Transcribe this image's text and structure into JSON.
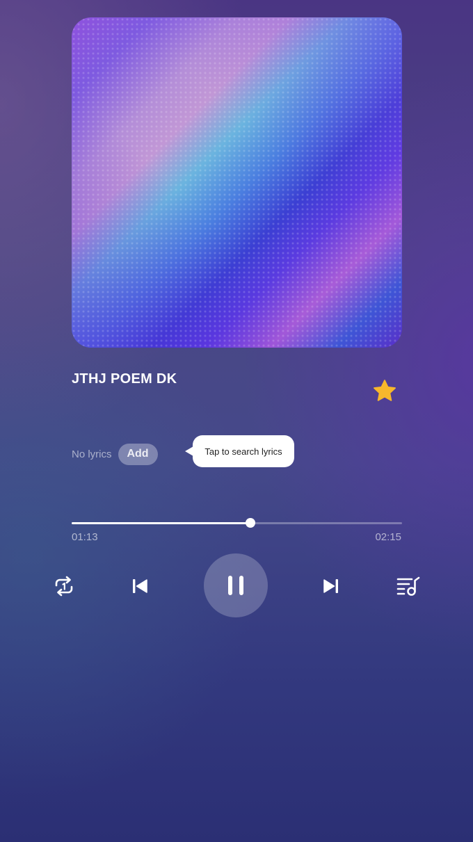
{
  "now_playing": {
    "title": "JTHJ POEM DK",
    "is_favorite": true,
    "favorite_icon": "star-icon",
    "favorite_color": "#f7b72c"
  },
  "lyrics": {
    "status_text": "No lyrics",
    "add_label": "Add",
    "tooltip_text": "Tap to search lyrics"
  },
  "progress": {
    "elapsed": "01:13",
    "total": "02:15",
    "fraction": 0.541
  },
  "controls": {
    "repeat_icon": "repeat-one-icon",
    "previous_icon": "skip-previous-icon",
    "play_pause_icon": "pause-icon",
    "next_icon": "skip-next-icon",
    "queue_icon": "playlist-music-icon"
  }
}
